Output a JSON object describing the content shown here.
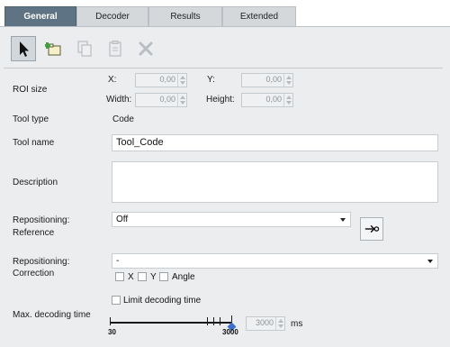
{
  "tabs": [
    {
      "label": "General",
      "active": true
    },
    {
      "label": "Decoder",
      "active": false
    },
    {
      "label": "Results",
      "active": false
    },
    {
      "label": "Extended",
      "active": false
    }
  ],
  "toolbar": {
    "items": [
      {
        "icon": "pointer-icon",
        "enabled": true,
        "selected": true
      },
      {
        "icon": "add-tool-icon",
        "enabled": true,
        "selected": false
      },
      {
        "icon": "copy-icon",
        "enabled": false,
        "selected": false
      },
      {
        "icon": "paste-icon",
        "enabled": false,
        "selected": false
      },
      {
        "icon": "delete-icon",
        "enabled": false,
        "selected": false
      }
    ]
  },
  "roi": {
    "label": "ROI size",
    "x_label": "X:",
    "x_value": "0,00",
    "y_label": "Y:",
    "y_value": "0,00",
    "width_label": "Width:",
    "width_value": "0,00",
    "height_label": "Height:",
    "height_value": "0,00"
  },
  "tool_type": {
    "label": "Tool type",
    "value": "Code"
  },
  "tool_name": {
    "label": "Tool name",
    "value": "Tool_Code"
  },
  "description": {
    "label": "Description",
    "value": ""
  },
  "repositioning_reference": {
    "label_line1": "Repositioning:",
    "label_line2": "Reference",
    "selected": "Off"
  },
  "repositioning_correction": {
    "label_line1": "Repositioning:",
    "label_line2": "Correction",
    "selected": "-",
    "checks": [
      {
        "label": "X",
        "checked": false
      },
      {
        "label": "Y",
        "checked": false
      },
      {
        "label": "Angle",
        "checked": false
      }
    ]
  },
  "decoding": {
    "label": "Max. decoding time",
    "limit_label": "Limit decoding time",
    "limit_checked": false,
    "min_label": "30",
    "max_label": "3000",
    "value": "3000",
    "unit": "ms"
  },
  "colors": {
    "active_tab": "#5e7383",
    "panel": "#ebedee",
    "slider_knob": "#3b6fd0"
  }
}
